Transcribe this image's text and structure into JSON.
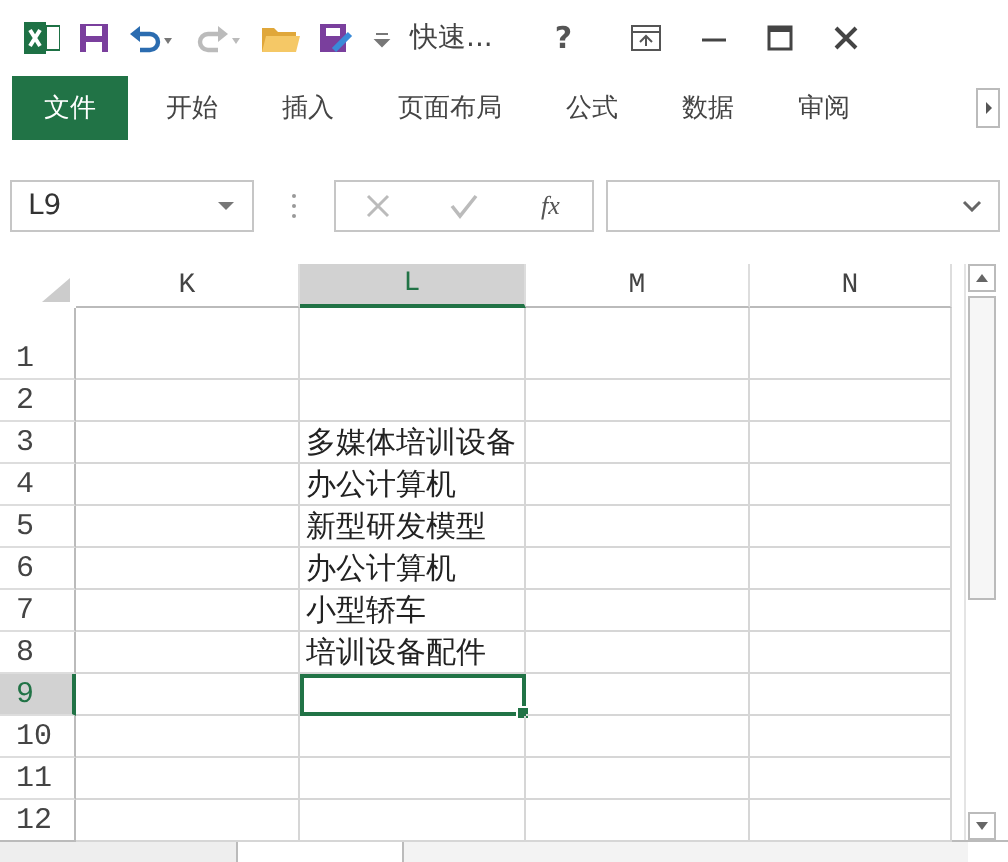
{
  "title_bar": {
    "quick_access_label": "快速...",
    "help": "?"
  },
  "ribbon_tabs": [
    {
      "label": "文件",
      "selected": true
    },
    {
      "label": "开始",
      "selected": false
    },
    {
      "label": "插入",
      "selected": false
    },
    {
      "label": "页面布局",
      "selected": false
    },
    {
      "label": "公式",
      "selected": false
    },
    {
      "label": "数据",
      "selected": false
    },
    {
      "label": "审阅",
      "selected": false
    }
  ],
  "name_box": {
    "value": "L9"
  },
  "formula_bar": {
    "function_label": "fx"
  },
  "columns": [
    {
      "label": "K",
      "selected": false
    },
    {
      "label": "L",
      "selected": true
    },
    {
      "label": "M",
      "selected": false
    },
    {
      "label": "N",
      "selected": false
    }
  ],
  "rows": [
    {
      "label": "1",
      "selected": false,
      "cells": [
        null,
        null,
        null,
        null
      ]
    },
    {
      "label": "2",
      "selected": false,
      "cells": [
        null,
        null,
        null,
        null
      ]
    },
    {
      "label": "3",
      "selected": false,
      "cells": [
        null,
        "多媒体培训设备",
        null,
        null
      ]
    },
    {
      "label": "4",
      "selected": false,
      "cells": [
        null,
        "办公计算机",
        null,
        null
      ]
    },
    {
      "label": "5",
      "selected": false,
      "cells": [
        null,
        "新型研发模型",
        null,
        null
      ]
    },
    {
      "label": "6",
      "selected": false,
      "cells": [
        null,
        "办公计算机",
        null,
        null
      ]
    },
    {
      "label": "7",
      "selected": false,
      "cells": [
        null,
        "小型轿车",
        null,
        null
      ]
    },
    {
      "label": "8",
      "selected": false,
      "cells": [
        null,
        "培训设备配件",
        null,
        null
      ]
    },
    {
      "label": "9",
      "selected": true,
      "cells": [
        null,
        null,
        null,
        null
      ]
    },
    {
      "label": "10",
      "selected": false,
      "cells": [
        null,
        null,
        null,
        null
      ]
    },
    {
      "label": "11",
      "selected": false,
      "cells": [
        null,
        null,
        null,
        null
      ]
    },
    {
      "label": "12",
      "selected": false,
      "cells": [
        null,
        null,
        null,
        null
      ]
    }
  ]
}
